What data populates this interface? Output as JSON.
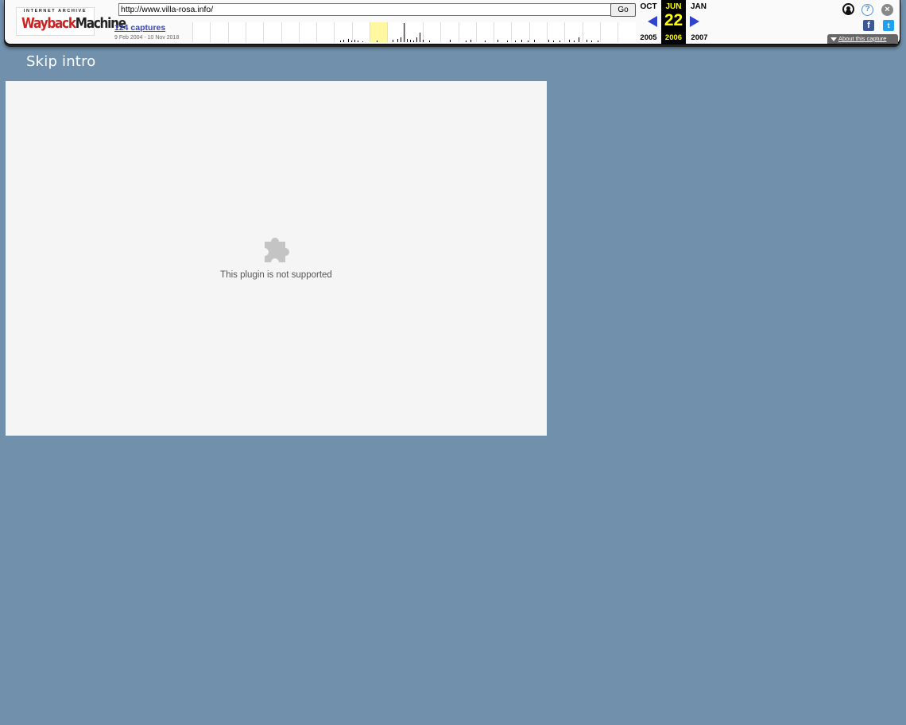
{
  "toolbar": {
    "logo_top": "INTERNET ARCHIVE",
    "logo_wayback": "Wayback",
    "logo_machine": "Machine",
    "url_value": "http://www.villa-rosa.info/",
    "go_label": "Go",
    "captures_label": "124 captures",
    "date_range": "9 Feb 2004 - 10 Nov 2018",
    "prev_month": "OCT",
    "current_month": "JUN",
    "next_month": "JAN",
    "current_day": "22",
    "prev_year": "2005",
    "current_year": "2006",
    "next_year": "2007",
    "about_label": "About this capture",
    "fb_glyph": "f",
    "tw_glyph": "t",
    "help_glyph": "?",
    "close_glyph": "×"
  },
  "page": {
    "skip_intro": "Skip intro",
    "plugin_message": "This plugin is not supported"
  },
  "colors": {
    "page_background": "#7090ac",
    "plugin_background": "#f5f5f5",
    "highlight_year": "#ffff00",
    "nav_arrow": "#3344cc"
  }
}
